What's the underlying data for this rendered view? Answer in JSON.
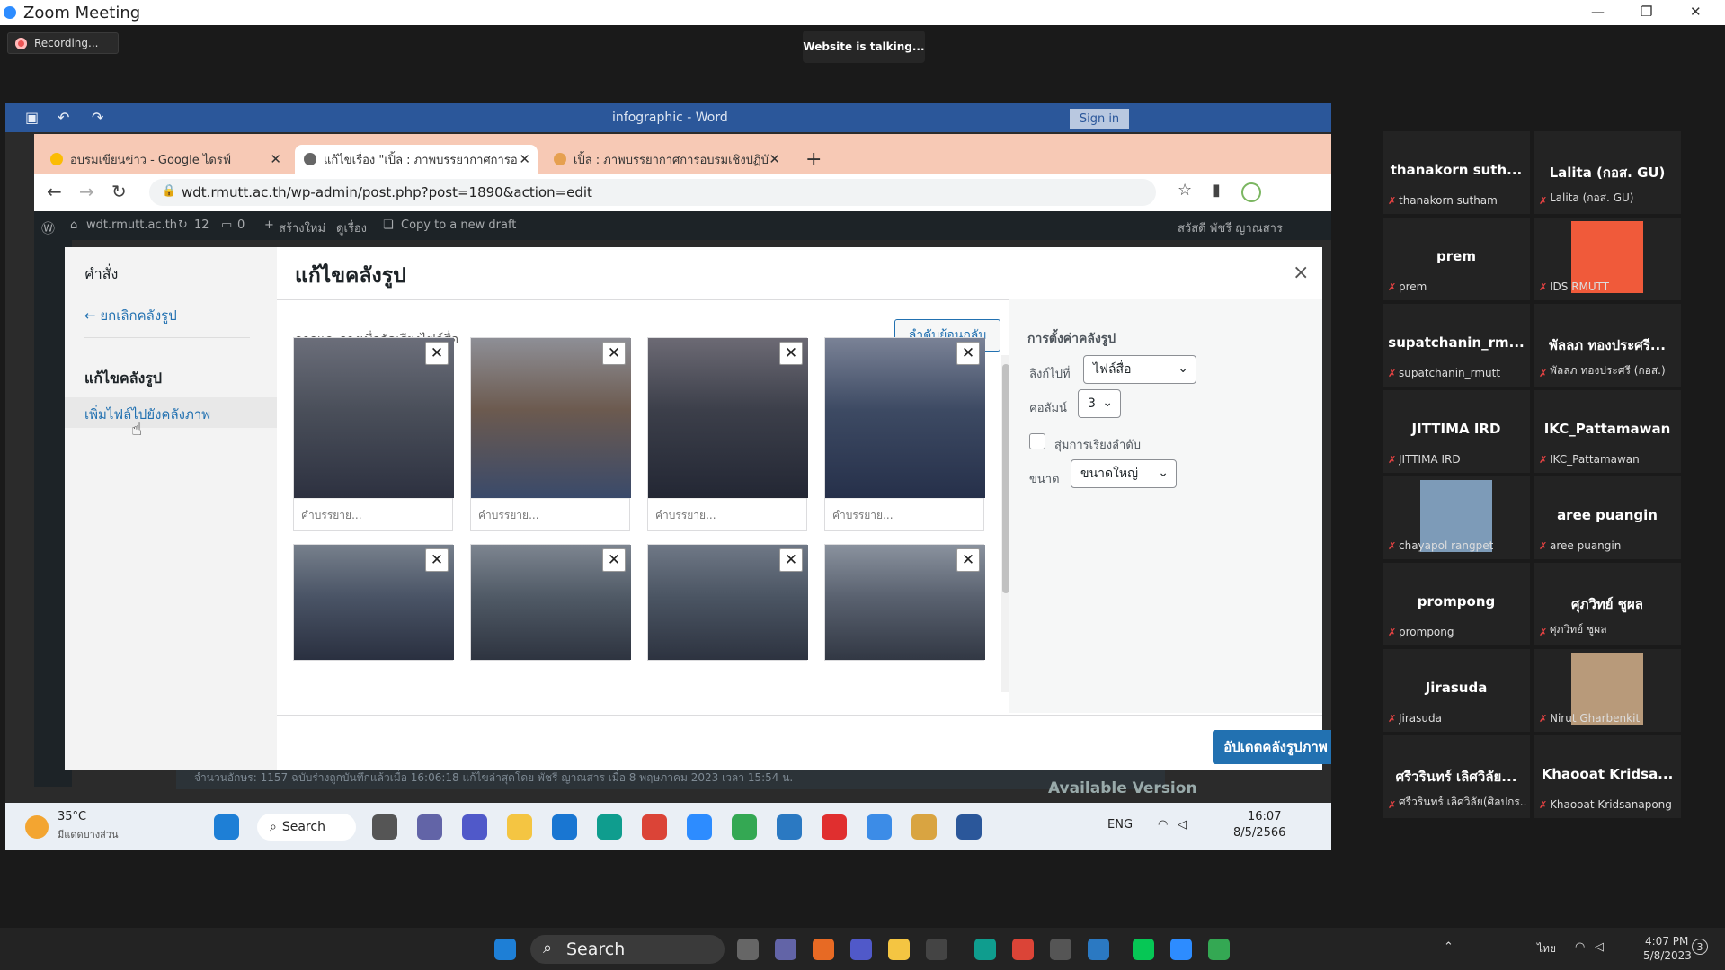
{
  "zoom": {
    "title": "Zoom Meeting",
    "recording_label": "Recording...",
    "talking_label": "Website is talking..."
  },
  "word": {
    "title": "infographic - Word",
    "signin": "Sign in"
  },
  "browser": {
    "tabs": [
      {
        "label": "อบรมเขียนข่าว - Google ไดรฟ์"
      },
      {
        "label": "แก้ไขเรื่อง \"เปิ้ล : ภาพบรรยากาศการอ"
      },
      {
        "label": "เปิ้ล : ภาพบรรยากาศการอบรมเชิงปฏิบั"
      }
    ],
    "new_tab": "+",
    "url": "wdt.rmutt.ac.th/wp-admin/post.php?post=1890&action=edit"
  },
  "wp_adminbar": {
    "site": "wdt.rmutt.ac.th",
    "updates": "12",
    "comments": "0",
    "new": "สร้างใหม่",
    "view": "ดูเรื่อง",
    "copy": "Copy to a new draft",
    "greeting": "สวัสดี พัชรี ญาณสาร"
  },
  "modal": {
    "sidebar_heading": "คำสั่ง",
    "cancel_link": "← ยกเลิกคลังรูป",
    "edit_heading": "แก้ไขคลังรูป",
    "add_link": "เพิ่มไฟล์ไปยังคลังภาพ",
    "title": "แก้ไขคลังรูป",
    "close": "×",
    "drag_hint": "ลากและวางเพื่อจัดเรียงไฟล์สื่อ",
    "reverse_button": "ลำดับย้อนกลับ",
    "thumb_remove": "✕",
    "caption_placeholder": "คำบรรยาย...",
    "settings": {
      "heading": "การตั้งค่าคลังรูป",
      "link_label": "ลิงก์ไปที่",
      "link_value": "ไฟล์สื่อ",
      "columns_label": "คอลัมน์",
      "columns_value": "3",
      "random_label": "สุ่มการเรียงลำดับ",
      "size_label": "ขนาด",
      "size_value": "ขนาดใหญ่"
    },
    "update_button": "อัปเดตคลังรูปภาพ"
  },
  "page_below": {
    "status": "จำนวนอักษร: 1157      ฉบับร่างถูกบันทึกแล้วเมื่อ 16:06:18 แก้ไขล่าสุดโดย พัชรี ญาณสาร เมื่อ 8 พฤษภาคม 2023 เวลา 15:54 น.",
    "available": "Available Version"
  },
  "inner_taskbar": {
    "weather_temp": "35°C",
    "weather_desc": "มีแดดบางส่วน",
    "search": "Search",
    "lang": "ENG",
    "time": "16:07",
    "date": "8/5/2566"
  },
  "participants": [
    {
      "name": "thanakorn   suth...",
      "sub": "thanakorn  sutham",
      "avatar": false
    },
    {
      "name": "Lalita (กอส. GU)",
      "sub": "Lalita (กอส. GU)",
      "avatar": false
    },
    {
      "name": "prem",
      "sub": "prem",
      "avatar": false
    },
    {
      "name": "",
      "sub": "IDS RMUTT",
      "avatar": true,
      "avatar_color": "#f05a3a"
    },
    {
      "name": "supatchanin_rm...",
      "sub": "supatchanin_rmutt",
      "avatar": false
    },
    {
      "name": "พัลลภ ทองประศรี...",
      "sub": "พัลลภ ทองประศรี (กอส.)",
      "avatar": false
    },
    {
      "name": "JITTIMA IRD",
      "sub": "JITTIMA IRD",
      "avatar": false
    },
    {
      "name": "IKC_Pattamawan",
      "sub": "IKC_Pattamawan",
      "avatar": false
    },
    {
      "name": "",
      "sub": "chayapol rangpet",
      "avatar": true,
      "avatar_color": "#7d9bb8"
    },
    {
      "name": "aree puangin",
      "sub": "aree puangin",
      "avatar": false
    },
    {
      "name": "prompong",
      "sub": "prompong",
      "avatar": false
    },
    {
      "name": "ศุภวิทย์ ชูผล",
      "sub": "ศุภวิทย์ ชูผล",
      "avatar": false
    },
    {
      "name": "Jirasuda",
      "sub": "Jirasuda",
      "avatar": false
    },
    {
      "name": "",
      "sub": "Nirut Gharbenkit",
      "avatar": true,
      "avatar_color": "#b89a7a"
    },
    {
      "name": "ศรีวรินทร์ เลิศวิลัย...",
      "sub": "ศรีวรินทร์ เลิศวิลัย(ศิลปกร...",
      "avatar": false
    },
    {
      "name": "Khaooat   Kridsa...",
      "sub": "Khaooat Kridsanapong",
      "avatar": false
    }
  ],
  "taskbar": {
    "search": "Search",
    "lang": "ไทย",
    "time": "4:07 PM",
    "date": "5/8/2023",
    "badge": "3"
  },
  "colors": {
    "wp_blue": "#2271b1",
    "word_blue": "#2b579a",
    "tab_strip": "#f7c9b5"
  }
}
